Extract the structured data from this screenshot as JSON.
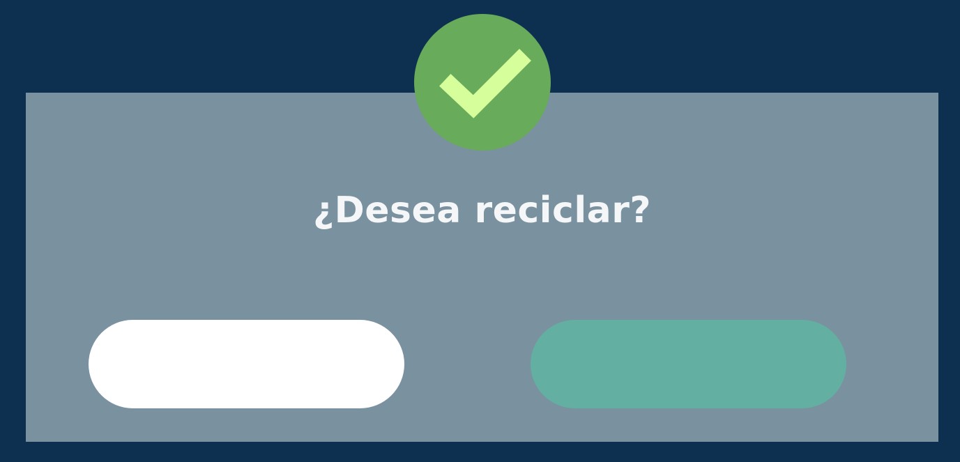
{
  "dialog": {
    "title": "¿Desea reciclar?",
    "icon": "checkmark-icon",
    "cancel_label": "",
    "confirm_label": ""
  },
  "colors": {
    "background": "#0e3050",
    "dialog": "#7a91a0",
    "badge": "#67ab5b",
    "checkmark": "#d6ff9c",
    "cancel_button": "#ffffff",
    "confirm_button": "#63afa1"
  }
}
